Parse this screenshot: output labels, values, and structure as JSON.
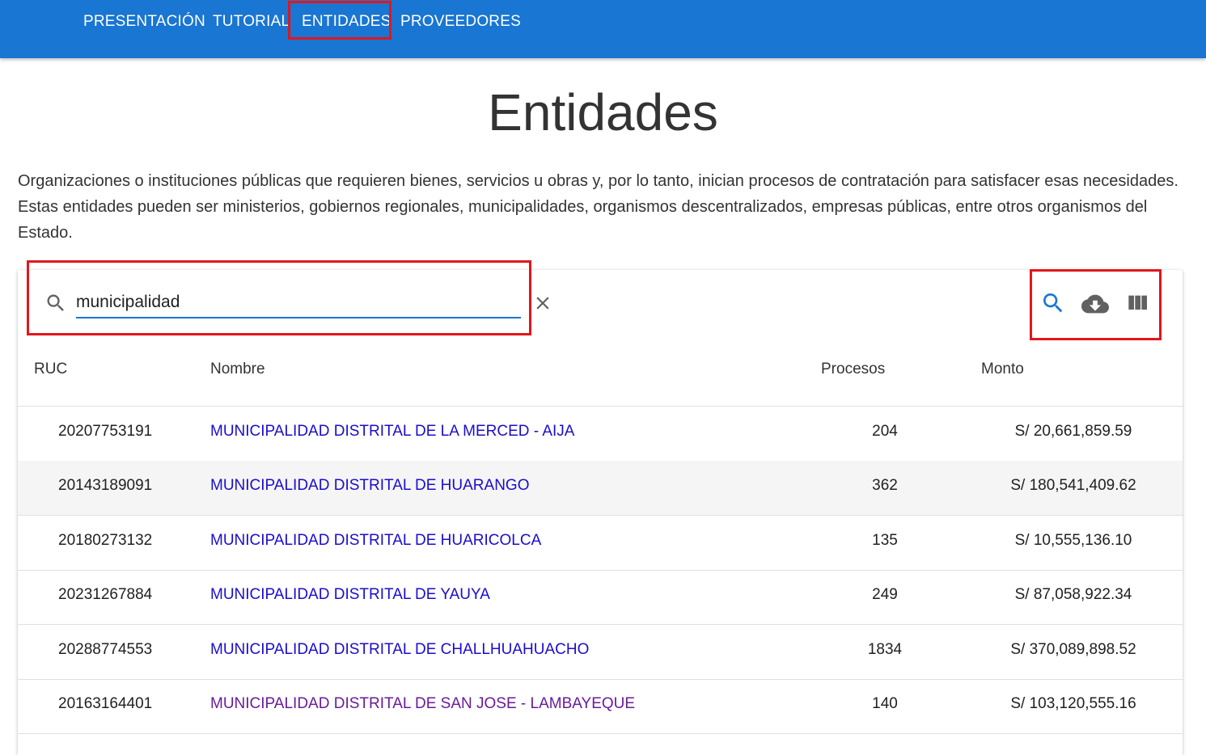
{
  "nav": {
    "items": [
      {
        "label": "PRESENTACIÓN"
      },
      {
        "label": "TUTORIAL"
      },
      {
        "label": "ENTIDADES"
      },
      {
        "label": "PROVEEDORES"
      }
    ]
  },
  "page": {
    "title": "Entidades",
    "description": "Organizaciones o instituciones públicas que requieren bienes, servicios u obras y, por lo tanto, inician procesos de contratación para satisfacer esas necesidades. Estas entidades pueden ser ministerios, gobiernos regionales, municipalidades, organismos descentralizados, empresas públicas, entre otros organismos del Estado."
  },
  "search": {
    "value": "municipalidad"
  },
  "toolbar": {
    "icons": [
      "search-icon",
      "cloud-download-icon",
      "view-column-icon"
    ],
    "accent": "#1976d2"
  },
  "table": {
    "headers": {
      "ruc": "RUC",
      "nombre": "Nombre",
      "procesos": "Procesos",
      "monto": "Monto"
    },
    "rows": [
      {
        "ruc": "20207753191",
        "nombre": "MUNICIPALIDAD DISTRITAL DE LA MERCED - AIJA",
        "procesos": "204",
        "monto": "S/ 20,661,859.59"
      },
      {
        "ruc": "20143189091",
        "nombre": "MUNICIPALIDAD DISTRITAL DE HUARANGO",
        "procesos": "362",
        "monto": "S/ 180,541,409.62"
      },
      {
        "ruc": "20180273132",
        "nombre": "MUNICIPALIDAD DISTRITAL DE HUARICOLCA",
        "procesos": "135",
        "monto": "S/ 10,555,136.10"
      },
      {
        "ruc": "20231267884",
        "nombre": "MUNICIPALIDAD DISTRITAL DE YAUYA",
        "procesos": "249",
        "monto": "S/ 87,058,922.34"
      },
      {
        "ruc": "20288774553",
        "nombre": "MUNICIPALIDAD DISTRITAL DE CHALLHUAHUACHO",
        "procesos": "1834",
        "monto": "S/ 370,089,898.52"
      },
      {
        "ruc": "20163164401",
        "nombre": "MUNICIPALIDAD DISTRITAL DE SAN JOSE - LAMBAYEQUE",
        "procesos": "140",
        "monto": "S/ 103,120,555.16"
      }
    ]
  },
  "colors": {
    "appbar": "#1976d2",
    "link": "#1a0dcc",
    "visited_link": "#6a1b9a",
    "highlight": "#e2161c"
  }
}
